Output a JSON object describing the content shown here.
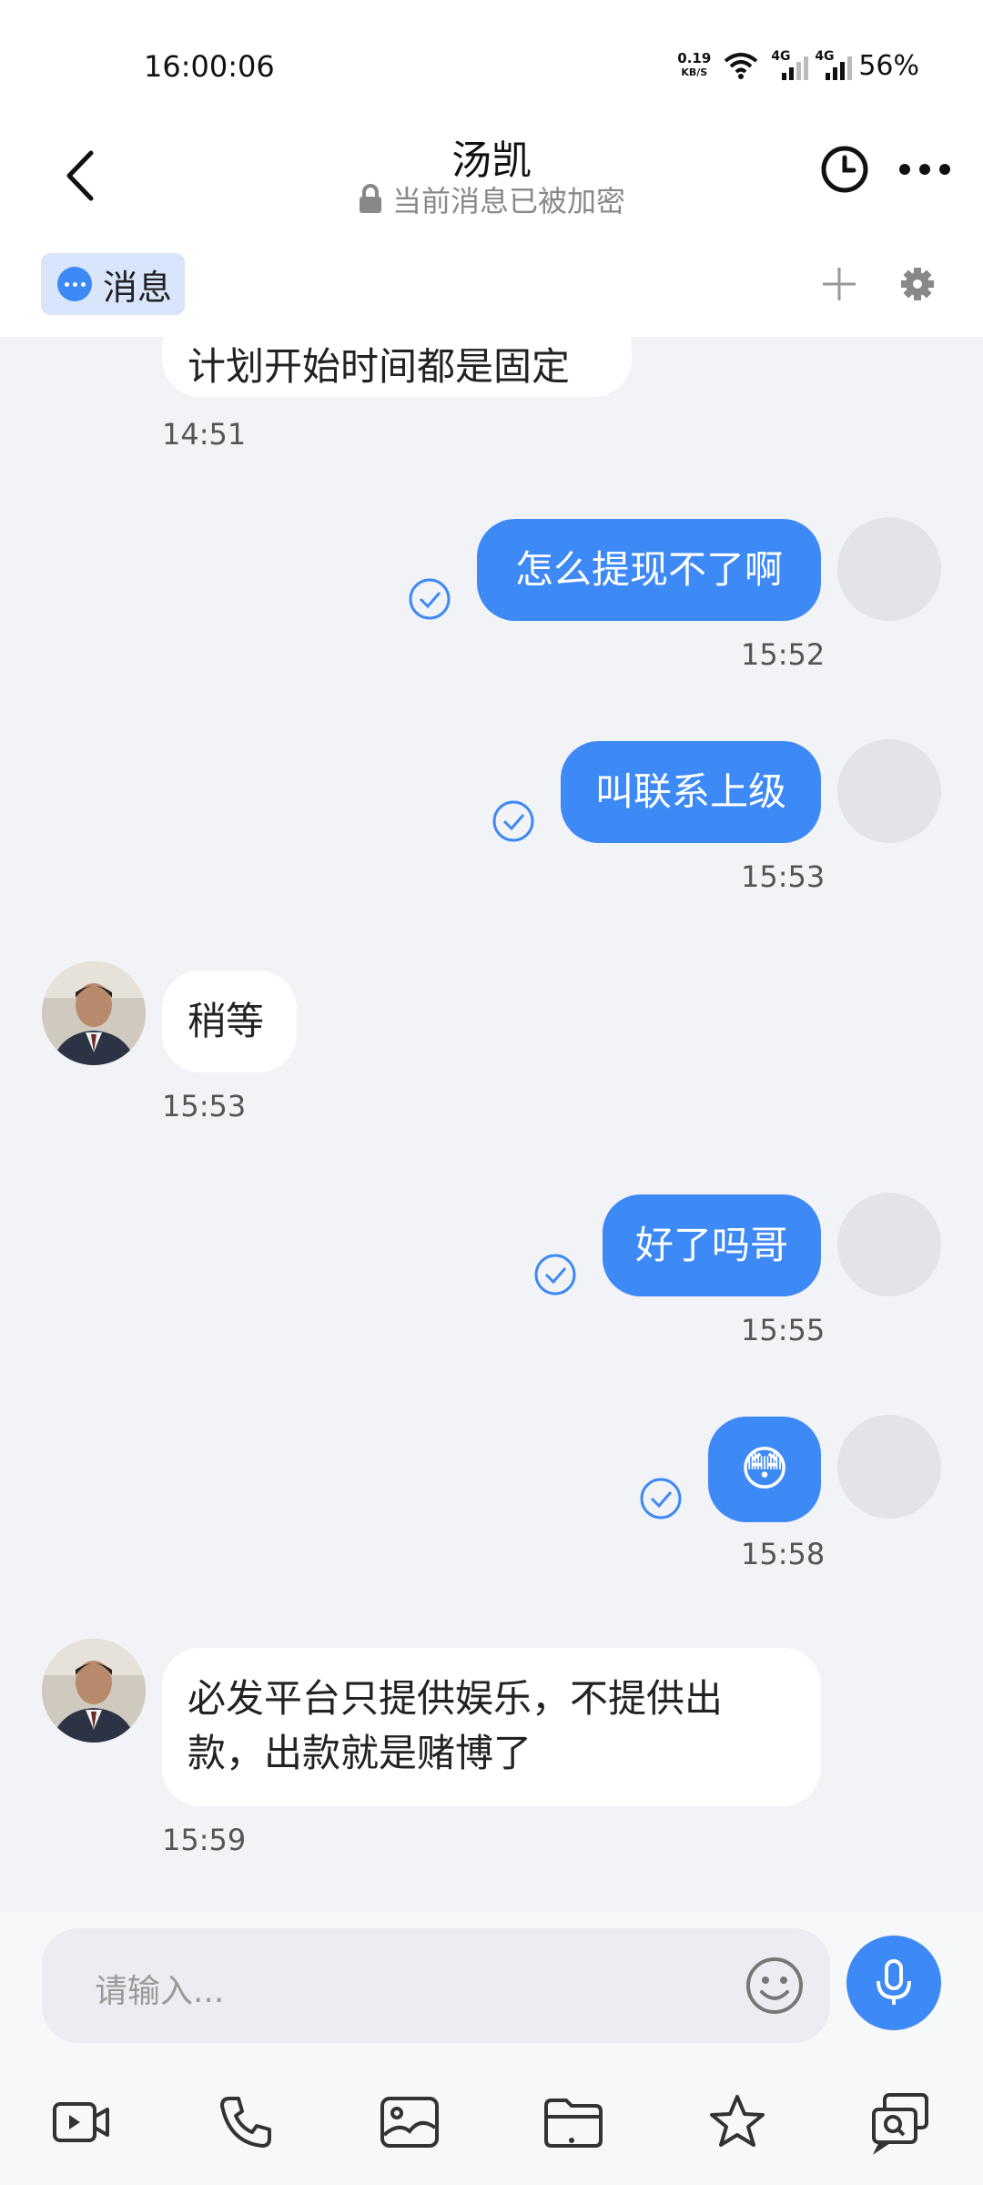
{
  "status_bar": {
    "time": "16:00:06",
    "net_speed_value": "0.19",
    "net_speed_unit": "KB/S",
    "signal_1": "4G",
    "signal_2": "4G",
    "battery": "56%"
  },
  "header": {
    "title": "汤凯",
    "subtitle": "当前消息已被加密"
  },
  "tabs": {
    "active_label": "消息"
  },
  "messages": [
    {
      "side": "in",
      "text": "计划开始时间都是固定",
      "time": "14:51"
    },
    {
      "side": "out",
      "text": "怎么提现不了啊",
      "time": "15:52",
      "read": true
    },
    {
      "side": "out",
      "text": "叫联系上级",
      "time": "15:53",
      "read": true
    },
    {
      "side": "in",
      "text": "稍等",
      "time": "15:53"
    },
    {
      "side": "out",
      "text": "好了吗哥",
      "time": "15:55",
      "read": true
    },
    {
      "side": "out",
      "text": "😳",
      "time": "15:58",
      "read": true
    },
    {
      "side": "in",
      "text_line1": "必发平台只提供娱乐，不提供出",
      "text_line2": "款，出款就是赌博了",
      "time": "15:59"
    }
  ],
  "composer": {
    "placeholder": "请输入..."
  },
  "colors": {
    "accent": "#3d89f5",
    "chat_background": "#f2f3f7",
    "incoming_bubble": "#ffffff"
  },
  "toolbar_icons": [
    "video-icon",
    "phone-icon",
    "image-icon",
    "folder-icon",
    "star-icon",
    "search-chat-icon"
  ]
}
